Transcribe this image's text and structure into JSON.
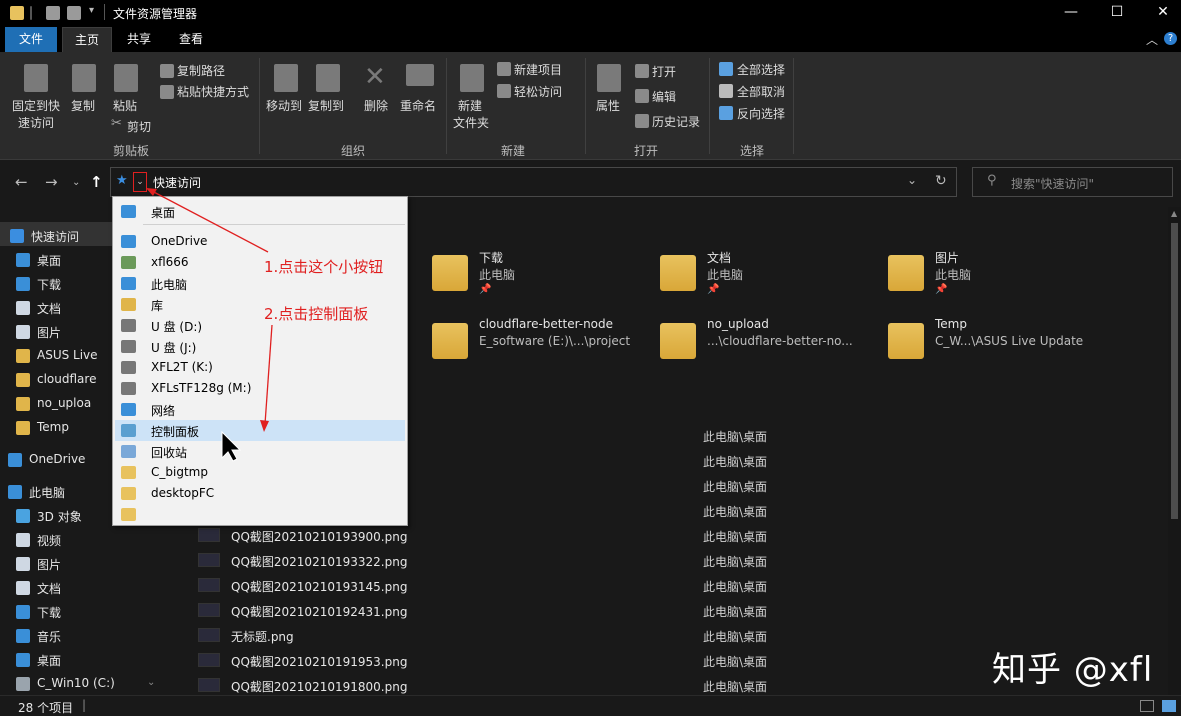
{
  "window": {
    "title": "文件资源管理器",
    "controls": {
      "minimize": "—",
      "maximize": "☐",
      "close": "✕"
    }
  },
  "ribbon_tabs": [
    "文件",
    "主页",
    "共享",
    "查看"
  ],
  "ribbon": {
    "clipboard": {
      "pin_label_1": "固定到快",
      "pin_label_2": "速访问",
      "copy": "复制",
      "paste": "粘贴",
      "copy_path": "复制路径",
      "paste_shortcut": "粘贴快捷方式",
      "cut": "剪切",
      "group": "剪贴板"
    },
    "organize": {
      "move_to": "移动到",
      "copy_to": "复制到",
      "delete": "删除",
      "rename": "重命名",
      "group": "组织"
    },
    "new": {
      "new_folder_1": "新建",
      "new_folder_2": "文件夹",
      "new_item": "新建项目",
      "easy_access": "轻松访问",
      "group": "新建"
    },
    "open": {
      "properties": "属性",
      "open": "打开",
      "edit": "编辑",
      "history": "历史记录",
      "group": "打开"
    },
    "select": {
      "select_all": "全部选择",
      "select_none": "全部取消",
      "invert": "反向选择",
      "group": "选择"
    }
  },
  "address": {
    "path": "快速访问",
    "search_placeholder": "搜索\"快速访问\""
  },
  "sidebar": {
    "items": [
      {
        "label": "快速访问",
        "icon": "star-icon",
        "color": "#3b8ee0"
      },
      {
        "label": "桌面",
        "icon": "desktop-icon",
        "color": "#3a8fd8"
      },
      {
        "label": "下载",
        "icon": "download-icon",
        "color": "#3a8fd8"
      },
      {
        "label": "文档",
        "icon": "document-icon",
        "color": "#cfd8e3"
      },
      {
        "label": "图片",
        "icon": "pictures-icon",
        "color": "#cfd8e3"
      },
      {
        "label": "ASUS Live",
        "icon": "folder-icon",
        "color": "#e0b54a"
      },
      {
        "label": "cloudflare",
        "icon": "folder-icon",
        "color": "#e0b54a"
      },
      {
        "label": "no_uploa",
        "icon": "folder-icon",
        "color": "#e0b54a"
      },
      {
        "label": "Temp",
        "icon": "folder-icon",
        "color": "#e0b54a"
      },
      {
        "label": "OneDrive",
        "icon": "cloud-icon",
        "color": "#3a8fd8"
      },
      {
        "label": "此电脑",
        "icon": "computer-icon",
        "color": "#3a8fd8"
      },
      {
        "label": "3D 对象",
        "icon": "cube-icon",
        "color": "#4aa3e0"
      },
      {
        "label": "视频",
        "icon": "video-icon",
        "color": "#cfd8e3"
      },
      {
        "label": "图片",
        "icon": "pictures-icon",
        "color": "#cfd8e3"
      },
      {
        "label": "文档",
        "icon": "document-icon",
        "color": "#cfd8e3"
      },
      {
        "label": "下载",
        "icon": "download-icon",
        "color": "#3a8fd8"
      },
      {
        "label": "音乐",
        "icon": "music-icon",
        "color": "#3a8fd8"
      },
      {
        "label": "桌面",
        "icon": "desktop-icon",
        "color": "#3a8fd8"
      },
      {
        "label": "C_Win10 (C:)",
        "icon": "drive-icon",
        "color": "#9aa4ad"
      }
    ]
  },
  "folders": [
    {
      "name": "下载",
      "sub": "此电脑",
      "pinned": true
    },
    {
      "name": "文档",
      "sub": "此电脑",
      "pinned": true
    },
    {
      "name": "图片",
      "sub": "此电脑",
      "pinned": true
    },
    {
      "name": "cloudflare-better-node",
      "sub": "E_software (E:)\\...\\project",
      "pinned": false
    },
    {
      "name": "no_upload",
      "sub": "...\\cloudflare-better-no...",
      "pinned": false
    },
    {
      "name": "Temp",
      "sub": "C_W...\\ASUS Live Update",
      "pinned": false
    }
  ],
  "files": [
    {
      "name": "",
      "location": "此电脑\\桌面"
    },
    {
      "name": "",
      "location": "此电脑\\桌面"
    },
    {
      "name": "",
      "location": "此电脑\\桌面"
    },
    {
      "name": "",
      "location": "此电脑\\桌面"
    },
    {
      "name": "QQ截图20210210193900.png",
      "location": "此电脑\\桌面"
    },
    {
      "name": "QQ截图20210210193322.png",
      "location": "此电脑\\桌面"
    },
    {
      "name": "QQ截图20210210193145.png",
      "location": "此电脑\\桌面"
    },
    {
      "name": "QQ截图20210210192431.png",
      "location": "此电脑\\桌面"
    },
    {
      "name": "无标题.png",
      "location": "此电脑\\桌面"
    },
    {
      "name": "QQ截图20210210191953.png",
      "location": "此电脑\\桌面"
    },
    {
      "name": "QQ截图20210210191800.png",
      "location": "此电脑\\桌面"
    }
  ],
  "dropdown": {
    "items": [
      {
        "label": "桌面",
        "icon": "desktop-icon",
        "color": "#3a8fd8"
      },
      {
        "label": "OneDrive",
        "icon": "cloud-icon",
        "color": "#3a8fd8"
      },
      {
        "label": "xfl666",
        "icon": "user-icon",
        "color": "#6b9a5a"
      },
      {
        "label": "此电脑",
        "icon": "computer-icon",
        "color": "#3a8fd8"
      },
      {
        "label": "库",
        "icon": "library-icon",
        "color": "#e0b54a"
      },
      {
        "label": "U 盘 (D:)",
        "icon": "drive-icon",
        "color": "#777777"
      },
      {
        "label": "U 盘 (J:)",
        "icon": "drive-icon",
        "color": "#777777"
      },
      {
        "label": "XFL2T (K:)",
        "icon": "drive-icon",
        "color": "#777777"
      },
      {
        "label": "XFLsTF128g (M:)",
        "icon": "drive-icon",
        "color": "#777777"
      },
      {
        "label": "网络",
        "icon": "network-icon",
        "color": "#3a8fd8"
      },
      {
        "label": "控制面板",
        "icon": "control-panel-icon",
        "color": "#5a9fd0"
      },
      {
        "label": "回收站",
        "icon": "recycle-bin-icon",
        "color": "#7aa8d8"
      },
      {
        "label": "C_bigtmp",
        "icon": "folder-icon",
        "color": "#e8c25e"
      },
      {
        "label": "desktopFC",
        "icon": "folder-icon",
        "color": "#e8c25e"
      },
      {
        "label": "",
        "icon": "zip-folder-icon",
        "color": "#e8c25e"
      }
    ],
    "highlighted": 10
  },
  "annotations": {
    "step1": "1.点击这个小按钮",
    "step2": "2.点击控制面板",
    "color": "#e02020"
  },
  "status": {
    "count": "28 个项目"
  },
  "watermark": "知乎 @xfl"
}
